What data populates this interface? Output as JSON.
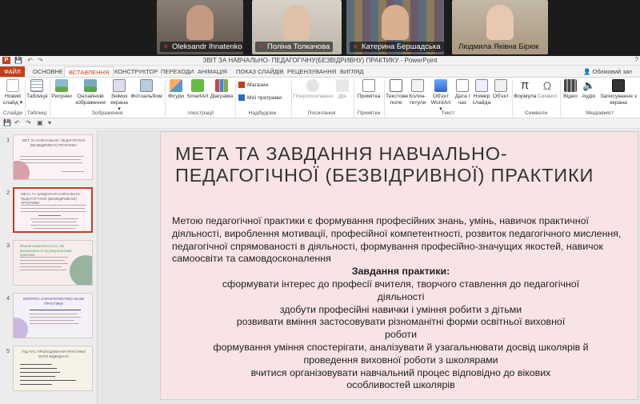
{
  "video": {
    "participants": [
      {
        "name": "Oleksandr Ihnatenko",
        "muted": true,
        "active": false
      },
      {
        "name": "Поліна Толкачова",
        "muted": true,
        "active": false
      },
      {
        "name": "Катерина Бершадська",
        "muted": true,
        "active": true
      },
      {
        "name": "Людмила Яківна Бірюк",
        "muted": false,
        "active": false
      }
    ]
  },
  "window": {
    "title": "ЗВІТ ЗА НАВЧАЛЬНО- ПЕДАГОГІЧНУ(БЕЗВІДРИВНУ) ПРАКТИКУ - PowerPoint",
    "logo": "P",
    "edge_char": "?"
  },
  "tabs": [
    "ФАЙЛ",
    "ОСНОВНЕ",
    "ВСТАВЛЕННЯ",
    "КОНСТРУКТОР",
    "ПЕРЕХОДИ",
    "АНІМАЦІЯ",
    "ПОКАЗ СЛАЙДІВ",
    "РЕЦЕНЗУВАННЯ",
    "ВИГЛЯД"
  ],
  "account": "Обліковий зап",
  "ribbon": {
    "buttons": {
      "new_slide": "Новий слайд ▾",
      "table": "Таблиця",
      "pictures": "Рисунки",
      "online_pictures": "Онлайнові зображення",
      "screenshot": "Знімок екрана ▾",
      "photo_album": "Фотоальбом",
      "shapes": "Фігури",
      "smartart": "SmartArt",
      "chart": "Діаграма",
      "store": "Магазин",
      "my_apps": "Мої програми",
      "hyperlink": "Гіперпосилання",
      "action": "Дія",
      "comment": "Примітка",
      "text_box": "Текстове поле",
      "header_footer": "Колон-титули",
      "wordart": "Об'єкт WordArt ▾",
      "date_time": "Дата і час",
      "slide_number": "Номер слайда",
      "object": "Об'єкт",
      "equation": "Формула",
      "symbol": "Символ",
      "video": "Відео",
      "audio": "Аудіо",
      "screen_recording": "Записування з екрана"
    },
    "groups": {
      "slides": "Слайди",
      "tables": "Таблиці",
      "images": "Зображення",
      "illustrations": "Ілюстрації",
      "addins": "Надбудови",
      "links": "Посилання",
      "comments": "Примітки",
      "text": "Текст",
      "symbols": "Символи",
      "media": "Медіавміст"
    }
  },
  "thumbnails": [
    {
      "num": "1",
      "title": "ЗВІТ ЗА НАВЧАЛЬНО- ПЕДАГОГІЧНУ (БЕЗВІДРИВНУ) ПРАКТИКУ"
    },
    {
      "num": "2",
      "title": "МЕТА ТА ЗАВДАННЯ НАВЧАЛЬНО-ПЕДАГОГІЧНОЇ (БЕЗВІДРИВНОЇ) ПРАКТИКИ"
    },
    {
      "num": "3",
      "title": "Фахові компетентності, які визначаються за результатами практики"
    },
    {
      "num": "4",
      "title": "КОРОТКА ХАРАКТЕРИСТИКА БАЗИ ПРАКТИКИ"
    },
    {
      "num": "5",
      "title": "ПІД ЧАС ПРОХОДЖЕННЯ ПРАКТИКИ БУЛО ВІДВІДАНО"
    }
  ],
  "slide": {
    "title": "МЕТА ТА ЗАВДАННЯ НАВЧАЛЬНО-ПЕДАГОГІЧНОЇ (БЕЗВІДРИВНОЇ) ПРАКТИКИ",
    "intro": "Метою педагогічної практики є формування професійних знань, умінь, навичок практичної діяльності, вироблення мотивації, професійної компетентності, розвиток педагогічного мислення, педагогічної спрямованості в діяльності, формування професійно-значущих якостей, навичок самоосвіти та самовдосконалення",
    "tasks_heading": "Завдання практики:",
    "tasks": [
      "сформувати інтерес до професії вчителя, творчого ставлення до педагогічної діяльності",
      "здобути професійні навички і уміння робити з дітьми",
      "розвивати вміння застосовувати різноманітні форми освітньої виховної роботи",
      "формування уміння спостерігати, аналізувати й узагальнювати досвід школярів й проведення виховної роботи з школярами",
      "вчитися організовувати навчальний процес відповідно до вікових особливостей школярів"
    ]
  },
  "colors": {
    "accent": "#c43e1c",
    "slide_bg": "#f8e3e5",
    "active_speaker": "#2ecc40"
  }
}
